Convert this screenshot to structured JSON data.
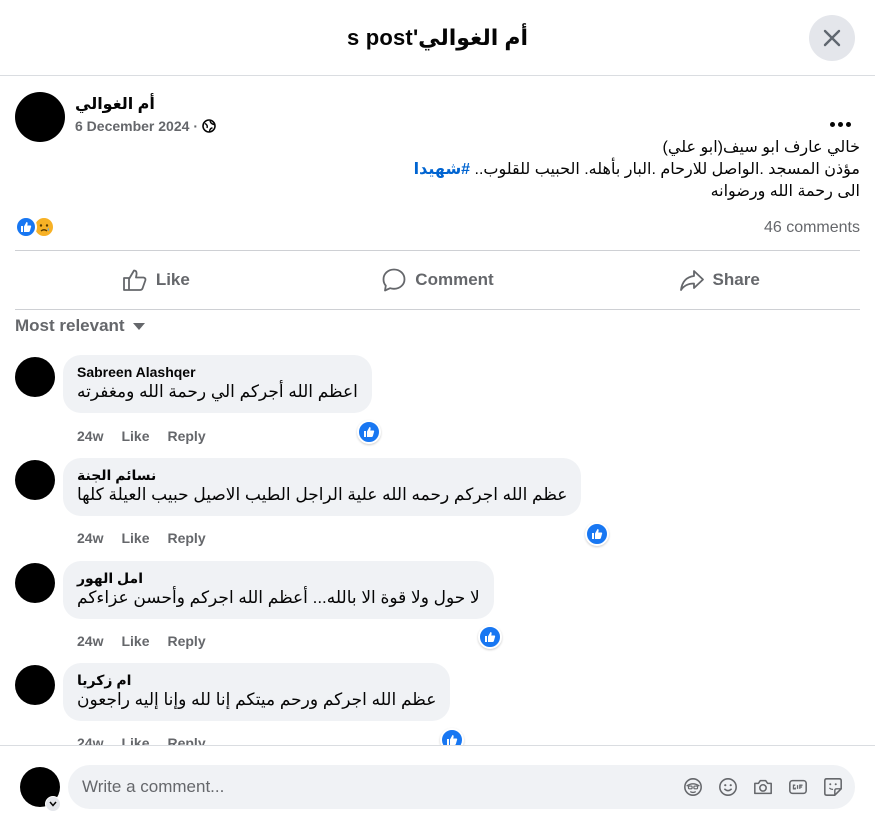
{
  "header": {
    "title": "أم الغوالي's post"
  },
  "post": {
    "author": "أم الغوالي",
    "date": "6 December 2024",
    "separator": "·",
    "line1": "خالي عارف ابو سيف(ابو علي)",
    "line2_text": "مؤذن المسجد .الواصل للارحام .البار بأهله. الحبيب للقلوب.. ",
    "line2_hashtag": "#شهيدا",
    "line3": "الى رحمة الله ورضوانه",
    "comments_count": "46 comments"
  },
  "actions": {
    "like": "Like",
    "comment": "Comment",
    "share": "Share"
  },
  "sort_label": "Most relevant",
  "comments": [
    {
      "name": "Sabreen Alashqer",
      "text": "اعظم الله أجركم الي رحمة الله ومغفرته",
      "time": "24w",
      "like": "Like",
      "reply": "Reply"
    },
    {
      "name": "نسائم الجنة",
      "text": "عظم الله اجركم رحمه الله علية الراجل الطيب الاصيل حبيب العيلة كلها",
      "time": "24w",
      "like": "Like",
      "reply": "Reply"
    },
    {
      "name": "امل الهور",
      "text": "لا حول ولا قوة الا بالله... أعظم الله اجركم وأحسن عزاءكم",
      "time": "24w",
      "like": "Like",
      "reply": "Reply"
    },
    {
      "name": "ام زكريا",
      "text": "عظم الله اجركم ورحم ميتكم إنا لله وإنا إليه راجعون",
      "time": "24w",
      "like": "Like",
      "reply": "Reply"
    }
  ],
  "composer": {
    "placeholder": "Write a comment..."
  },
  "colors": {
    "accent": "#1877f2",
    "hashtag": "#0064d1",
    "muted": "#65676b",
    "bubble": "#f0f2f5"
  }
}
